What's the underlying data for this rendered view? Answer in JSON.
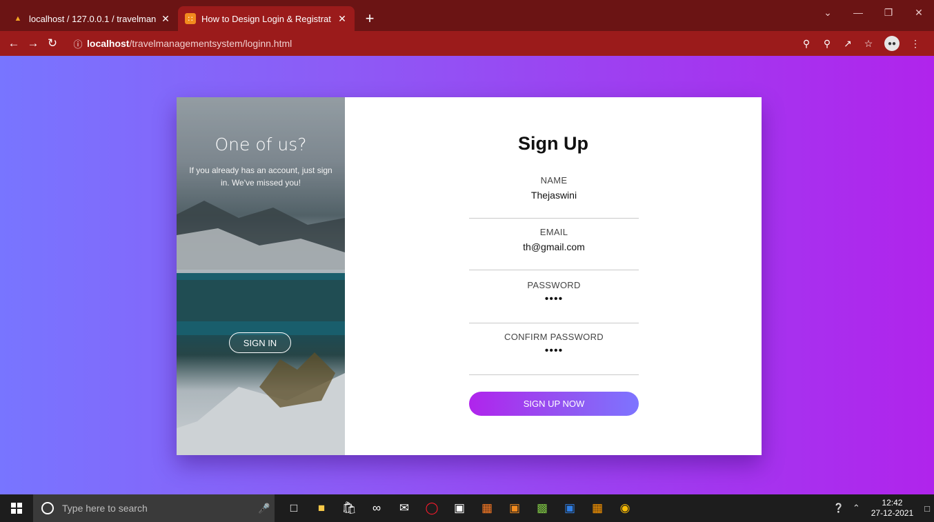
{
  "browser": {
    "tabs": [
      {
        "title": "localhost / 127.0.0.1 / travelmana",
        "active": false,
        "icon": "phpmyadmin-icon"
      },
      {
        "title": "How to Design Login & Registrat",
        "active": true,
        "icon": "codepen-icon"
      }
    ],
    "new_tab": "+",
    "url_host": "localhost",
    "url_path": "/travelmanagementsystem/loginn.html"
  },
  "side_panel": {
    "title": "One of us?",
    "text": "If you already has an account, just sign in. We've missed you!",
    "button_label": "SIGN IN"
  },
  "form": {
    "title": "Sign Up",
    "fields": [
      {
        "label": "NAME",
        "value": "Thejaswini"
      },
      {
        "label": "EMAIL",
        "value": "th@gmail.com"
      },
      {
        "label": "PASSWORD",
        "value": "••••"
      },
      {
        "label": "CONFIRM PASSWORD",
        "value": "••••"
      }
    ],
    "submit_label": "SIGN UP NOW"
  },
  "taskbar": {
    "search_placeholder": "Type here to search",
    "time": "12:42",
    "date": "27-12-2021"
  },
  "colors": {
    "chrome": "#9b1b1b",
    "gradient_start": "#7875ff",
    "gradient_end": "#b024ec"
  }
}
